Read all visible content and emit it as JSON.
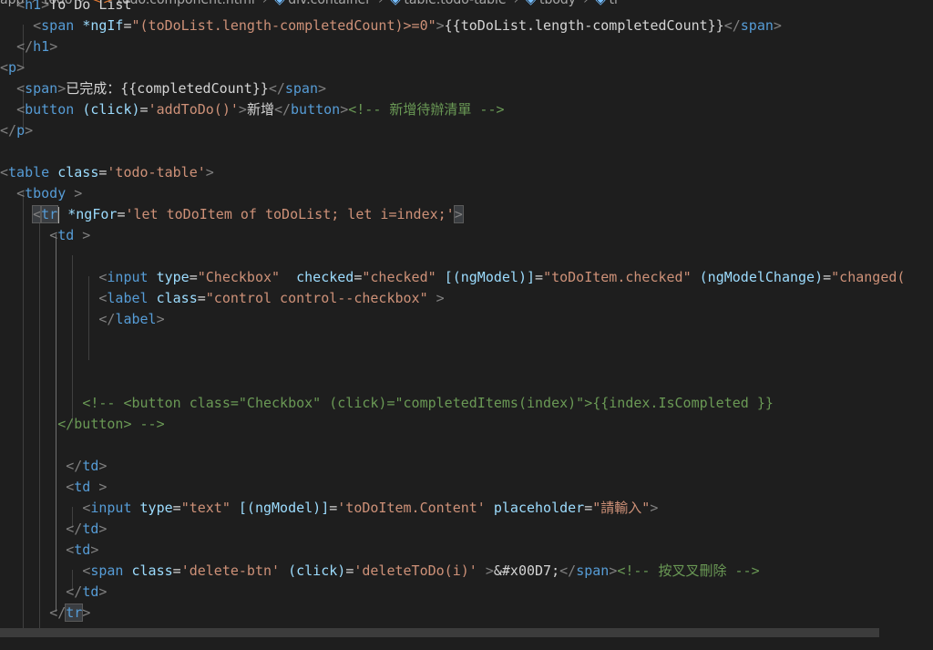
{
  "breadcrumb": {
    "items": [
      "app",
      "todo",
      "todo.component.html",
      "div.container",
      "table.todo-table",
      "tbody",
      "tr"
    ]
  },
  "code": {
    "l1": [
      "<",
      "h1",
      ">",
      "To Do List"
    ],
    "l2": [
      "<",
      "span",
      " ",
      "*ngIf",
      "=",
      "\"(toDoList.length-completedCount)>=0\"",
      ">",
      "{{toDoList.length-completedCount}}",
      "</",
      "span",
      ">"
    ],
    "l3": [
      "</",
      "h1",
      ">"
    ],
    "l4": [
      "<",
      "p",
      ">"
    ],
    "l5": [
      "<",
      "span",
      ">",
      "已完成：{{completedCount}}",
      "</",
      "span",
      ">"
    ],
    "l6": [
      "<",
      "button",
      " ",
      "(click)",
      "=",
      "'addToDo()'",
      ">",
      "新增",
      "</",
      "button",
      ">",
      "<!-- 新增待辦清單 -->"
    ],
    "l7": [
      "</",
      "p",
      ">"
    ],
    "l8": [],
    "l9": [
      "<",
      "table",
      " ",
      "class",
      "=",
      "'todo-table'",
      ">"
    ],
    "l10": [
      "<",
      "tbody",
      " >"
    ],
    "l11": [
      "<",
      "tr",
      " ",
      "*ngFor",
      "=",
      "'let toDoItem of toDoList; let i=index;'",
      ">"
    ],
    "l12": [
      "<",
      "td",
      " >"
    ],
    "l13": [],
    "l14": [
      "<",
      "input",
      " ",
      "type",
      "=",
      "\"Checkbox\"",
      "  ",
      "checked",
      "=",
      "\"checked\"",
      " ",
      "[(ngModel)]",
      "=",
      "\"toDoItem.checked\"",
      " ",
      "(ngModelChange)",
      "=",
      "\"changed("
    ],
    "l15": [
      "<",
      "label",
      " ",
      "class",
      "=",
      "\"control control--checkbox\"",
      " >"
    ],
    "l16": [
      "</",
      "label",
      ">"
    ],
    "l20": [
      "<!-- <button class=\"Checkbox\" (click)=\"completedItems(index)\">{{index.IsCompleted }}"
    ],
    "l21": [
      "</button> -->"
    ],
    "l23": [
      "</",
      "td",
      ">"
    ],
    "l24": [
      "<",
      "td",
      " >"
    ],
    "l25": [
      "<",
      "input",
      " ",
      "type",
      "=",
      "\"text\"",
      " ",
      "[(ngModel)]",
      "=",
      "'toDoItem.Content'",
      " ",
      "placeholder",
      "=",
      "\"請輸入\"",
      ">"
    ],
    "l26": [
      "</",
      "td",
      ">"
    ],
    "l27": [
      "<",
      "td",
      ">"
    ],
    "l28": [
      "<",
      "span",
      " ",
      "class",
      "=",
      "'delete-btn'",
      " ",
      "(click)",
      "=",
      "'deleteToDo(i)'",
      " >",
      "&#x00D7;",
      "</",
      "span",
      ">",
      "<!-- 按叉叉刪除 -->"
    ],
    "l29": [
      "</",
      "td",
      ">"
    ],
    "l30": [
      "</",
      "tr",
      ">"
    ]
  }
}
